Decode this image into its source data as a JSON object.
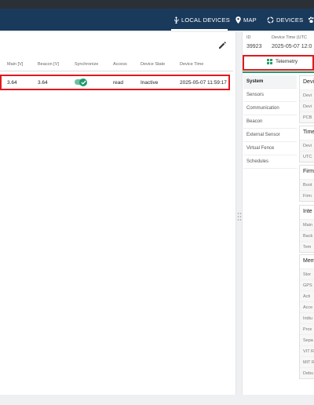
{
  "nav": {
    "local_devices": "LOCAL DEVICES",
    "map": "MAP",
    "devices": "DEVICES"
  },
  "table": {
    "headers": {
      "main": "Main [V]",
      "beacon": "Beacon [V]",
      "synchronize": "Synchronize",
      "access": "Access",
      "device_state": "Device State",
      "device_time": "Device Time"
    },
    "row": {
      "main": "3.64",
      "beacon": "3.64",
      "synchronize_on": true,
      "access": "read",
      "device_state": "Inactive",
      "device_time": "2025-05-07 11:59:17"
    }
  },
  "detail": {
    "id_label": "ID",
    "id_value": "39923",
    "time_label": "Device Time (UTC",
    "time_value": "2025-05-07 12:0",
    "telemetry_tab": "Telemetry",
    "menu": [
      "System",
      "Sensors",
      "Communication",
      "Beacon",
      "External Sensor",
      "Virtual Fence",
      "Schedules"
    ],
    "sections": [
      {
        "title": "Devi",
        "rows": [
          "Devi",
          "Devi",
          "PCB"
        ]
      },
      {
        "title": "Time",
        "rows": [
          "Devi",
          "UTC"
        ]
      },
      {
        "title": "Firm",
        "rows": [
          "Boot",
          "Firm"
        ]
      },
      {
        "title": "Inte",
        "rows": [
          "Main",
          "Back",
          "Tem"
        ]
      },
      {
        "title": "Mem",
        "rows": [
          "Stor",
          "GPS",
          "Acti",
          "Acce",
          "Iridiu",
          "Prox",
          "Sepa",
          "VIT R",
          "MIT R",
          "Debu"
        ]
      }
    ]
  },
  "colors": {
    "nav_bg": "#1a3a5c",
    "accent_green": "#1d9a6c",
    "highlight_red": "#e0191f"
  }
}
